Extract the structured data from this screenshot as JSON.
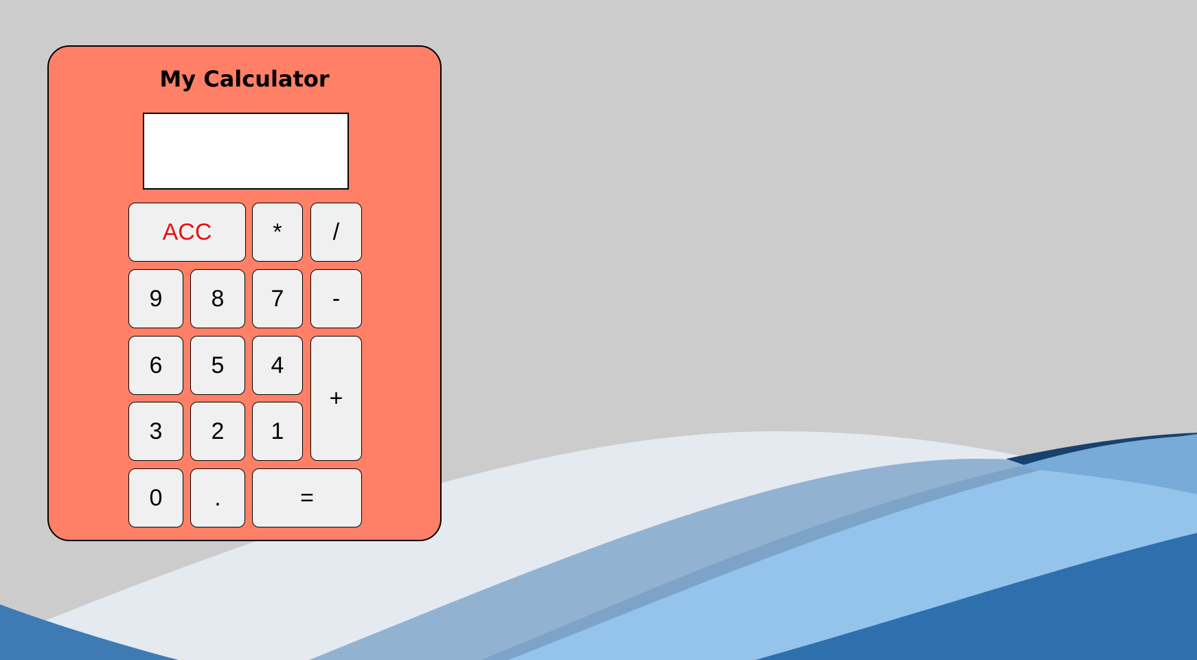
{
  "app": {
    "title": "My Calculator",
    "display_value": ""
  },
  "keys": {
    "acc": "ACC",
    "multiply": "*",
    "divide": "/",
    "nine": "9",
    "eight": "8",
    "seven": "7",
    "minus": "-",
    "six": "6",
    "five": "5",
    "four": "4",
    "plus": "+",
    "three": "3",
    "two": "2",
    "one": "1",
    "zero": "0",
    "dot": ".",
    "equals": "="
  },
  "colors": {
    "page_background": "#cccccc",
    "calculator_body": "#ff8066",
    "key_background": "#f0f0f0",
    "clear_key_text": "#e81010",
    "wave_light": "#e4eaf0",
    "wave_mid": "#92b2d2",
    "wave_sky": "#94c3ec",
    "wave_dark": "#2e70ad",
    "wave_navy": "#17416f"
  }
}
